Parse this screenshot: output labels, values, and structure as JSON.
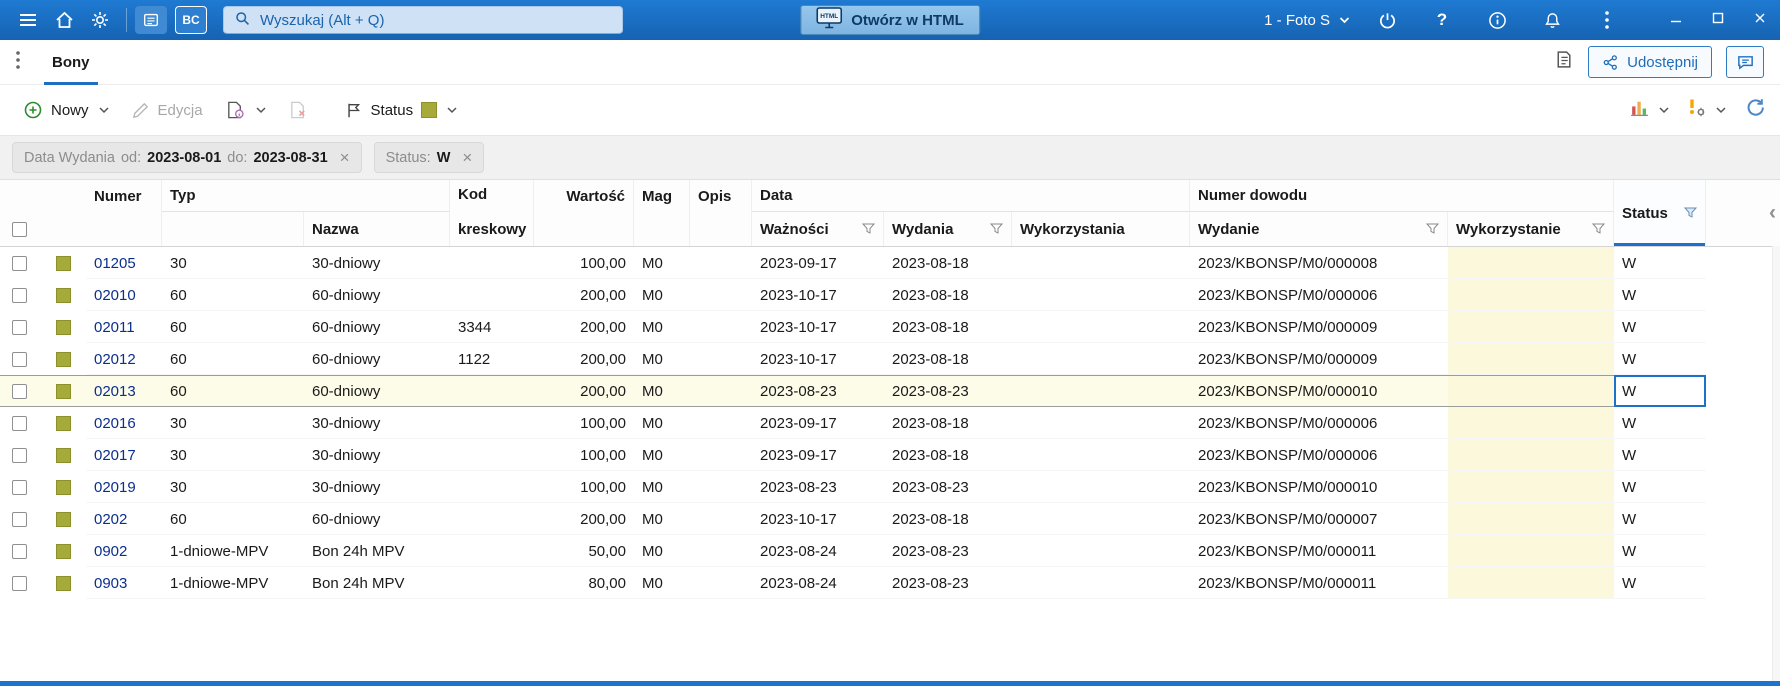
{
  "topbar": {
    "search": {
      "placeholder": "Wyszukaj (Alt + Q)"
    },
    "open_html": "Otwórz w HTML",
    "html_badge": "HTML",
    "bc_badge": "BC",
    "profile": "1 - Foto S"
  },
  "tabbar": {
    "tab": "Bony",
    "share": "Udostępnij"
  },
  "toolbar": {
    "new": "Nowy",
    "edit": "Edycja",
    "status": "Status"
  },
  "filterbar": {
    "date_chip": {
      "label": "Data Wydania",
      "from_label": "od:",
      "from": "2023-08-01",
      "to_label": "do:",
      "to": "2023-08-31"
    },
    "status_chip": {
      "label": "Status:",
      "value": "W"
    }
  },
  "icons": {
    "help": "?",
    "close_x": "×",
    "collapse": "‹"
  },
  "table": {
    "headers": {
      "numer": "Numer",
      "typ": "Typ",
      "nazwa": "Nazwa",
      "kod_1": "Kod",
      "kod_2": "kreskowy",
      "wartosc": "Wartość",
      "mag": "Mag",
      "opis": "Opis",
      "data_group": "Data",
      "waznosci": "Ważności",
      "wydania": "Wydania",
      "wykorzystania": "Wykorzystania",
      "dowod_group": "Numer dowodu",
      "wydanie": "Wydanie",
      "wykorzystanie": "Wykorzystanie",
      "status": "Status"
    },
    "rows": [
      {
        "numer": "01205",
        "typ": "30",
        "nazwa": "30-dniowy",
        "kod": "",
        "wartosc": "100,00",
        "mag": "M0",
        "opis": "",
        "waznosci": "2023-09-17",
        "wydania": "2023-08-18",
        "wykorzystania": "",
        "dowod_wydanie": "2023/KBONSP/M0/000008",
        "dowod_wykorzystanie": "",
        "status": "W",
        "selected": false
      },
      {
        "numer": "02010",
        "typ": "60",
        "nazwa": "60-dniowy",
        "kod": "",
        "wartosc": "200,00",
        "mag": "M0",
        "opis": "",
        "waznosci": "2023-10-17",
        "wydania": "2023-08-18",
        "wykorzystania": "",
        "dowod_wydanie": "2023/KBONSP/M0/000006",
        "dowod_wykorzystanie": "",
        "status": "W",
        "selected": false
      },
      {
        "numer": "02011",
        "typ": "60",
        "nazwa": "60-dniowy",
        "kod": "3344",
        "wartosc": "200,00",
        "mag": "M0",
        "opis": "",
        "waznosci": "2023-10-17",
        "wydania": "2023-08-18",
        "wykorzystania": "",
        "dowod_wydanie": "2023/KBONSP/M0/000009",
        "dowod_wykorzystanie": "",
        "status": "W",
        "selected": false
      },
      {
        "numer": "02012",
        "typ": "60",
        "nazwa": "60-dniowy",
        "kod": "1122",
        "wartosc": "200,00",
        "mag": "M0",
        "opis": "",
        "waznosci": "2023-10-17",
        "wydania": "2023-08-18",
        "wykorzystania": "",
        "dowod_wydanie": "2023/KBONSP/M0/000009",
        "dowod_wykorzystanie": "",
        "status": "W",
        "selected": false
      },
      {
        "numer": "02013",
        "typ": "60",
        "nazwa": "60-dniowy",
        "kod": "",
        "wartosc": "200,00",
        "mag": "M0",
        "opis": "",
        "waznosci": "2023-08-23",
        "wydania": "2023-08-23",
        "wykorzystania": "",
        "dowod_wydanie": "2023/KBONSP/M0/000010",
        "dowod_wykorzystanie": "",
        "status": "W",
        "selected": true
      },
      {
        "numer": "02016",
        "typ": "30",
        "nazwa": "30-dniowy",
        "kod": "",
        "wartosc": "100,00",
        "mag": "M0",
        "opis": "",
        "waznosci": "2023-09-17",
        "wydania": "2023-08-18",
        "wykorzystania": "",
        "dowod_wydanie": "2023/KBONSP/M0/000006",
        "dowod_wykorzystanie": "",
        "status": "W",
        "selected": false
      },
      {
        "numer": "02017",
        "typ": "30",
        "nazwa": "30-dniowy",
        "kod": "",
        "wartosc": "100,00",
        "mag": "M0",
        "opis": "",
        "waznosci": "2023-09-17",
        "wydania": "2023-08-18",
        "wykorzystania": "",
        "dowod_wydanie": "2023/KBONSP/M0/000006",
        "dowod_wykorzystanie": "",
        "status": "W",
        "selected": false
      },
      {
        "numer": "02019",
        "typ": "30",
        "nazwa": "30-dniowy",
        "kod": "",
        "wartosc": "100,00",
        "mag": "M0",
        "opis": "",
        "waznosci": "2023-08-23",
        "wydania": "2023-08-23",
        "wykorzystania": "",
        "dowod_wydanie": "2023/KBONSP/M0/000010",
        "dowod_wykorzystanie": "",
        "status": "W",
        "selected": false
      },
      {
        "numer": "0202",
        "typ": "60",
        "nazwa": "60-dniowy",
        "kod": "",
        "wartosc": "200,00",
        "mag": "M0",
        "opis": "",
        "waznosci": "2023-10-17",
        "wydania": "2023-08-18",
        "wykorzystania": "",
        "dowod_wydanie": "2023/KBONSP/M0/000007",
        "dowod_wykorzystanie": "",
        "status": "W",
        "selected": false
      },
      {
        "numer": "0902",
        "typ": "1-dniowe-MPV",
        "nazwa": "Bon 24h MPV",
        "kod": "",
        "wartosc": "50,00",
        "mag": "M0",
        "opis": "",
        "waznosci": "2023-08-24",
        "wydania": "2023-08-23",
        "wykorzystania": "",
        "dowod_wydanie": "2023/KBONSP/M0/000011",
        "dowod_wykorzystanie": "",
        "status": "W",
        "selected": false
      },
      {
        "numer": "0903",
        "typ": "1-dniowe-MPV",
        "nazwa": "Bon 24h MPV",
        "kod": "",
        "wartosc": "80,00",
        "mag": "M0",
        "opis": "",
        "waznosci": "2023-08-24",
        "wydania": "2023-08-23",
        "wykorzystania": "",
        "dowod_wydanie": "2023/KBONSP/M0/000011",
        "dowod_wykorzystanie": "",
        "status": "W",
        "selected": false
      }
    ]
  },
  "colors": {
    "accent_blue": "#1b72c8",
    "topbar_blue": "#1a6fc4",
    "swatch_olive": "#a6aa3a",
    "selected_row_bg": "#fdfce9",
    "editable_cell_bg": "#fbf8dc",
    "numer_text": "#0b2f8f"
  }
}
